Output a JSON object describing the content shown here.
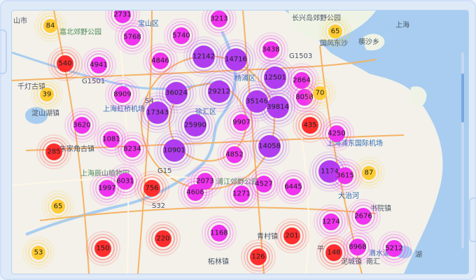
{
  "colors": {
    "red": "#ff2d2d",
    "magenta": "#ef33ef",
    "purple": "#b03cf0",
    "yellow": "#ffcc33",
    "water": "#a8cdf0",
    "land": "#f3f1ea"
  },
  "clusters": [
    {
      "value": "84",
      "color": "yellow"
    },
    {
      "value": "2731",
      "color": "magenta"
    },
    {
      "value": "5768",
      "color": "magenta"
    },
    {
      "value": "5740",
      "color": "magenta"
    },
    {
      "value": "3213",
      "color": "magenta"
    },
    {
      "value": "65",
      "color": "yellow"
    },
    {
      "value": "540",
      "color": "red"
    },
    {
      "value": "4941",
      "color": "magenta"
    },
    {
      "value": "4846",
      "color": "magenta"
    },
    {
      "value": "12142",
      "color": "purple"
    },
    {
      "value": "14716",
      "color": "purple"
    },
    {
      "value": "3438",
      "color": "magenta"
    },
    {
      "value": "39",
      "color": "yellow"
    },
    {
      "value": "8909",
      "color": "magenta"
    },
    {
      "value": "36024",
      "color": "purple"
    },
    {
      "value": "29212",
      "color": "purple"
    },
    {
      "value": "12501",
      "color": "purple"
    },
    {
      "value": "2864",
      "color": "magenta"
    },
    {
      "value": "8058",
      "color": "magenta"
    },
    {
      "value": "70",
      "color": "yellow"
    },
    {
      "value": "17343",
      "color": "purple"
    },
    {
      "value": "35146",
      "color": "purple"
    },
    {
      "value": "39814",
      "color": "purple"
    },
    {
      "value": "3620",
      "color": "magenta"
    },
    {
      "value": "25990",
      "color": "purple"
    },
    {
      "value": "9907",
      "color": "magenta"
    },
    {
      "value": "435",
      "color": "red"
    },
    {
      "value": "4250",
      "color": "magenta"
    },
    {
      "value": "1081",
      "color": "magenta"
    },
    {
      "value": "285",
      "color": "red"
    },
    {
      "value": "8234",
      "color": "magenta"
    },
    {
      "value": "10901",
      "color": "purple"
    },
    {
      "value": "4852",
      "color": "magenta"
    },
    {
      "value": "14058",
      "color": "purple"
    },
    {
      "value": "1174",
      "color": "purple"
    },
    {
      "value": "3615",
      "color": "magenta"
    },
    {
      "value": "87",
      "color": "yellow"
    },
    {
      "value": "6031",
      "color": "magenta"
    },
    {
      "value": "1997",
      "color": "magenta"
    },
    {
      "value": "756",
      "color": "red"
    },
    {
      "value": "4606",
      "color": "magenta"
    },
    {
      "value": "2073",
      "color": "magenta"
    },
    {
      "value": "1271",
      "color": "magenta"
    },
    {
      "value": "4527",
      "color": "magenta"
    },
    {
      "value": "6445",
      "color": "magenta"
    },
    {
      "value": "65",
      "color": "yellow"
    },
    {
      "value": "2676",
      "color": "magenta"
    },
    {
      "value": "1274",
      "color": "magenta"
    },
    {
      "value": "220",
      "color": "red"
    },
    {
      "value": "1168",
      "color": "magenta"
    },
    {
      "value": "201",
      "color": "red"
    },
    {
      "value": "53",
      "color": "yellow"
    },
    {
      "value": "150",
      "color": "red"
    },
    {
      "value": "126",
      "color": "red"
    },
    {
      "value": "148",
      "color": "red"
    },
    {
      "value": "8968",
      "color": "magenta"
    },
    {
      "value": "5212",
      "color": "magenta"
    }
  ],
  "places": [
    {
      "text": "山市"
    },
    {
      "text": "嘉北郊野公园"
    },
    {
      "text": "宝山区"
    },
    {
      "text": "长兴岛郊野公园"
    },
    {
      "text": "国风东沙"
    },
    {
      "text": "横沙乡"
    },
    {
      "text": "上海"
    },
    {
      "text": "千灯古镇"
    },
    {
      "text": "淀山湖镇"
    },
    {
      "text": "上海虹桥机场"
    },
    {
      "text": "杨浦区"
    },
    {
      "text": "徐汇区"
    },
    {
      "text": "上海浦东国际机场"
    },
    {
      "text": "朱家角古镇"
    },
    {
      "text": "上海辰山植物园"
    },
    {
      "text": "浦江郊野公园"
    },
    {
      "text": "大治河"
    },
    {
      "text": "书院镇"
    },
    {
      "text": "青村镇"
    },
    {
      "text": "柘林镇"
    },
    {
      "text": "平"
    },
    {
      "text": "滴水湖"
    },
    {
      "text": "湖"
    },
    {
      "text": "泥城镇"
    },
    {
      "text": "南汇"
    },
    {
      "text": "G1503"
    },
    {
      "text": "G1501"
    },
    {
      "text": "G15"
    },
    {
      "text": "S32"
    },
    {
      "text": "S4"
    }
  ]
}
